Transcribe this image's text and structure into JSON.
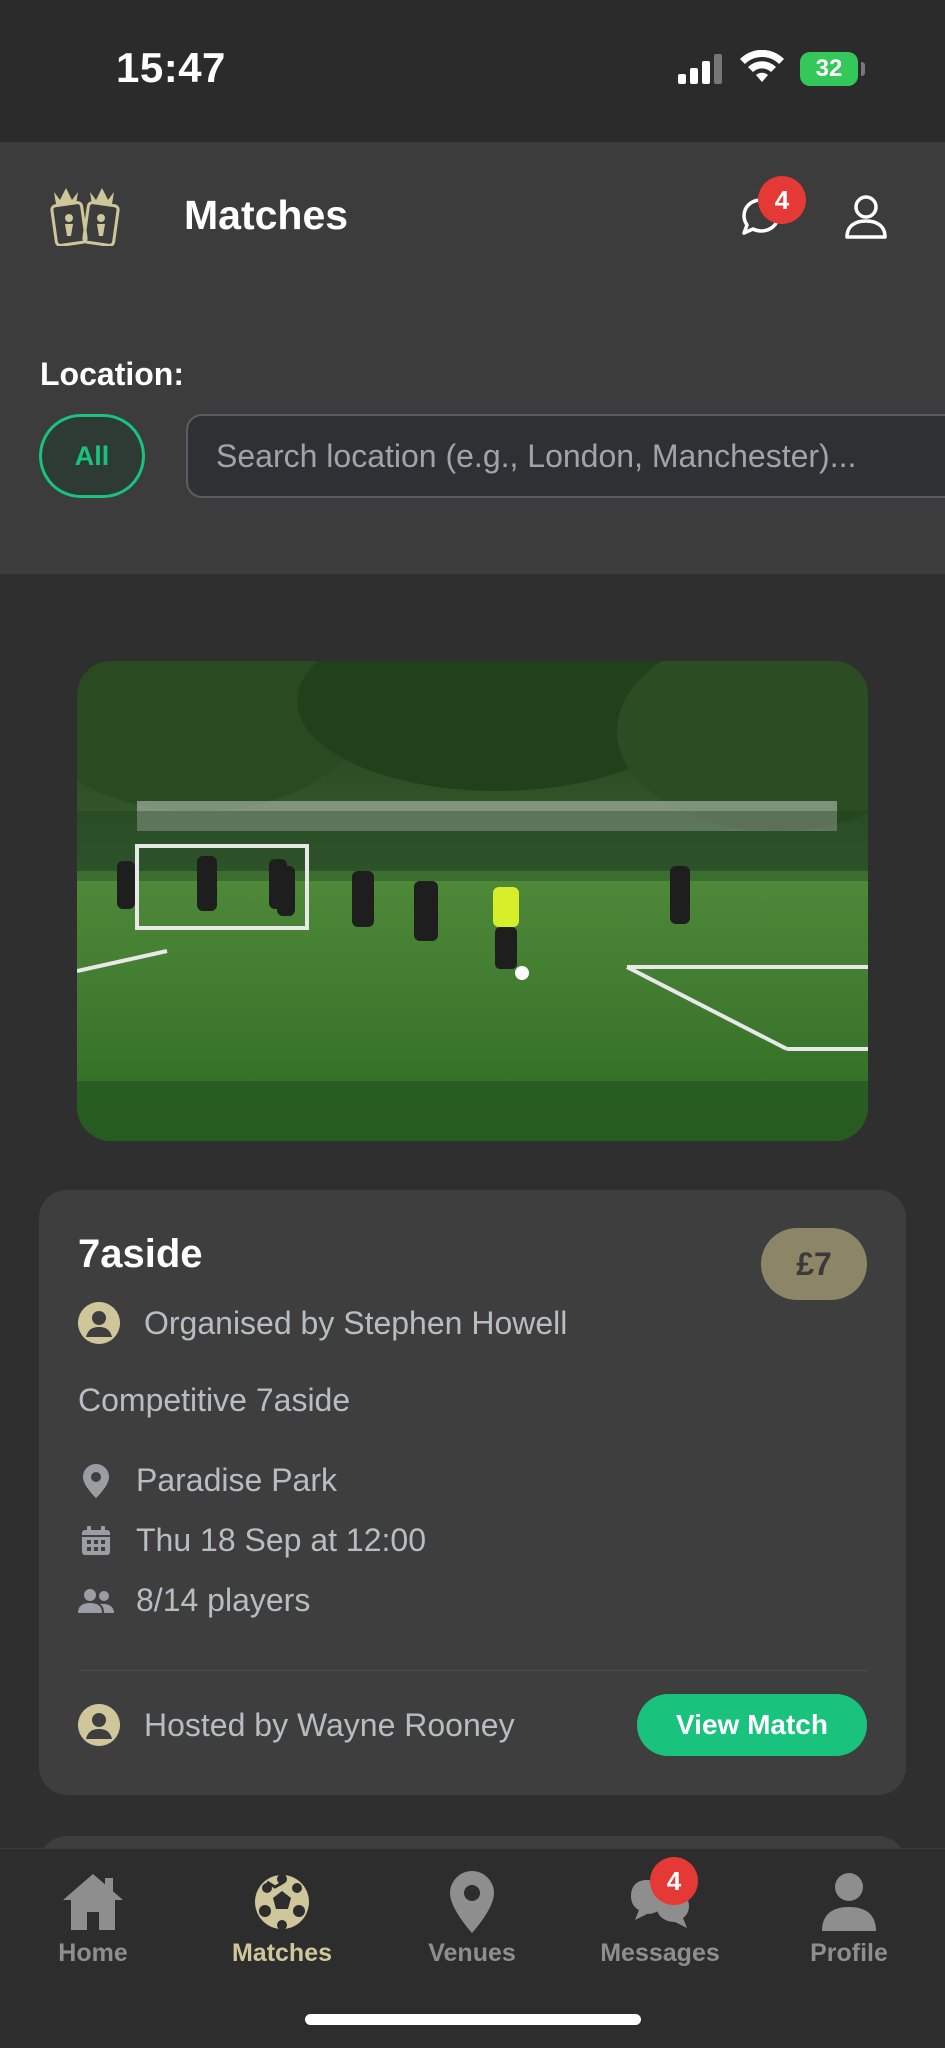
{
  "status_bar": {
    "time": "15:47",
    "battery": "32",
    "icons": [
      "signal-icon",
      "wifi-icon",
      "battery-icon"
    ]
  },
  "header": {
    "title": "Matches",
    "notification_count": "4",
    "icons": [
      "logo",
      "chat-icon",
      "user-icon"
    ]
  },
  "filter": {
    "location_label": "Location:",
    "all_chip": "All",
    "search_placeholder": "Search location (e.g., London, Manchester)..."
  },
  "match_card": {
    "title": "7aside",
    "price": "£7",
    "organiser": "Organised by Stephen Howell",
    "description": "Competitive 7aside",
    "venue": "Paradise Park",
    "date": "Thu 18 Sep at 12:00",
    "players": "8/14 players",
    "host": "Hosted by Wayne Rooney",
    "view_button": "View Match"
  },
  "tabs": [
    {
      "label": "Home",
      "icon": "home-icon",
      "active": false
    },
    {
      "label": "Matches",
      "icon": "soccer-ball-icon",
      "active": true
    },
    {
      "label": "Venues",
      "icon": "map-pin-icon",
      "active": false
    },
    {
      "label": "Messages",
      "icon": "chat-icon",
      "active": false,
      "badge": "4"
    },
    {
      "label": "Profile",
      "icon": "user-icon",
      "active": false
    }
  ],
  "colors": {
    "accent_green": "#19c37d",
    "gold": "#cfc79b",
    "badge_red": "#e53935",
    "background": "#2f2f2f"
  }
}
